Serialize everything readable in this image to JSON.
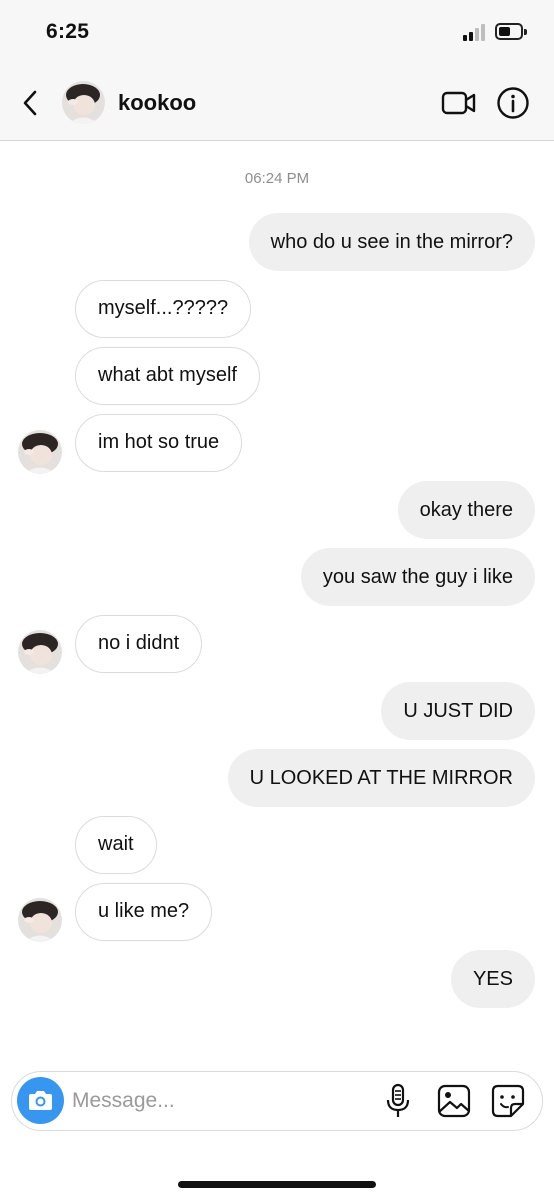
{
  "status_bar": {
    "time": "6:25"
  },
  "header": {
    "username": "kookoo",
    "icons": {
      "back": "chevron-left-icon",
      "video": "video-camera-icon",
      "info": "info-icon"
    }
  },
  "chat": {
    "timestamp": "06:24 PM",
    "messages": [
      {
        "sender": "me",
        "text": "who do u see in the mirror?"
      },
      {
        "sender": "kookoo",
        "text": "myself...?????"
      },
      {
        "sender": "kookoo",
        "text": "what abt myself"
      },
      {
        "sender": "kookoo",
        "text": "im hot so true"
      },
      {
        "sender": "me",
        "text": "okay there"
      },
      {
        "sender": "me",
        "text": "you saw the guy i like"
      },
      {
        "sender": "kookoo",
        "text": "no i didnt"
      },
      {
        "sender": "me",
        "text": "U JUST DID"
      },
      {
        "sender": "me",
        "text": "U LOOKED AT THE MIRROR"
      },
      {
        "sender": "kookoo",
        "text": "wait"
      },
      {
        "sender": "kookoo",
        "text": "u like me?"
      },
      {
        "sender": "me",
        "text": "YES"
      }
    ]
  },
  "composer": {
    "placeholder": "Message...",
    "icons": {
      "camera": "camera-icon",
      "mic": "microphone-icon",
      "gallery": "gallery-icon",
      "sticker": "sticker-icon"
    }
  },
  "colors": {
    "accent": "#3797f0",
    "sent_bubble": "#efefef",
    "received_border": "#dbdbdb",
    "header_bg": "#f7f7f7"
  }
}
